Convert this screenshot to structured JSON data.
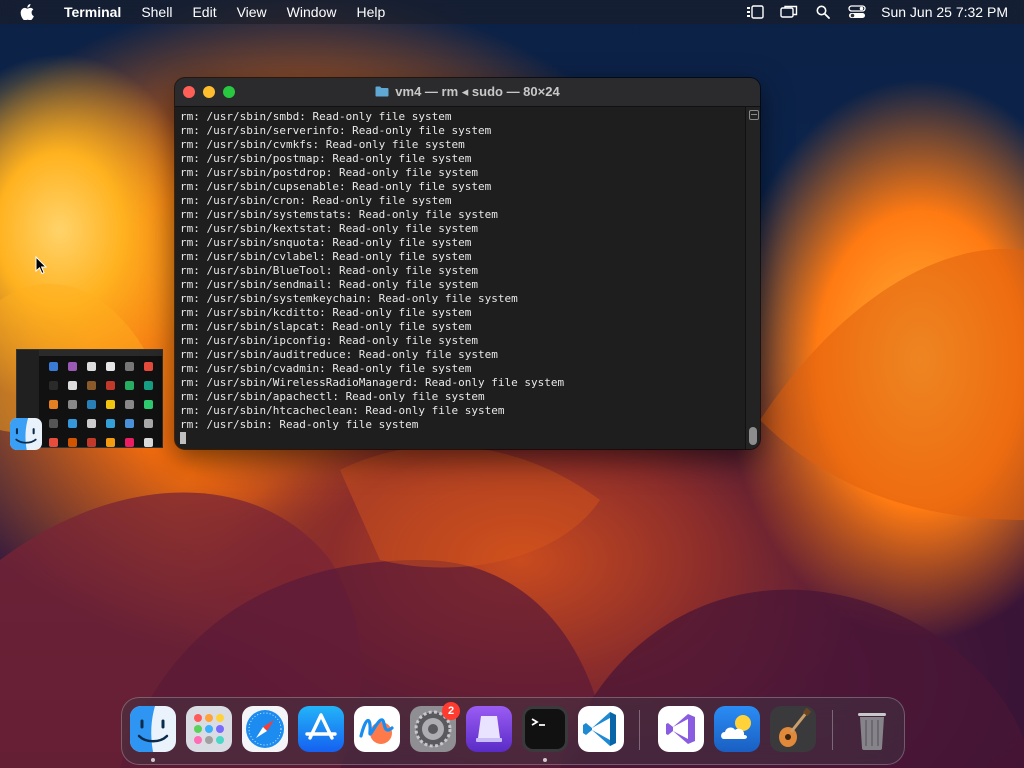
{
  "menubar": {
    "app_name": "Terminal",
    "menus": [
      "Shell",
      "Edit",
      "View",
      "Window",
      "Help"
    ],
    "clock": "Sun Jun 25  7:32 PM"
  },
  "terminal": {
    "title": "vm4 — rm ◂ sudo — 80×24",
    "lines": [
      "rm: /usr/sbin/smbd: Read-only file system",
      "rm: /usr/sbin/serverinfo: Read-only file system",
      "rm: /usr/sbin/cvmkfs: Read-only file system",
      "rm: /usr/sbin/postmap: Read-only file system",
      "rm: /usr/sbin/postdrop: Read-only file system",
      "rm: /usr/sbin/cupsenable: Read-only file system",
      "rm: /usr/sbin/cron: Read-only file system",
      "rm: /usr/sbin/systemstats: Read-only file system",
      "rm: /usr/sbin/kextstat: Read-only file system",
      "rm: /usr/sbin/snquota: Read-only file system",
      "rm: /usr/sbin/cvlabel: Read-only file system",
      "rm: /usr/sbin/BlueTool: Read-only file system",
      "rm: /usr/sbin/sendmail: Read-only file system",
      "rm: /usr/sbin/systemkeychain: Read-only file system",
      "rm: /usr/sbin/kcditto: Read-only file system",
      "rm: /usr/sbin/slapcat: Read-only file system",
      "rm: /usr/sbin/ipconfig: Read-only file system",
      "rm: /usr/sbin/auditreduce: Read-only file system",
      "rm: /usr/sbin/cvadmin: Read-only file system",
      "rm: /usr/sbin/WirelessRadioManagerd: Read-only file system",
      "rm: /usr/sbin/apachectl: Read-only file system",
      "rm: /usr/sbin/htcacheclean: Read-only file system",
      "rm: /usr/sbin: Read-only file system"
    ]
  },
  "dock": {
    "settings_badge": "2"
  },
  "colors": {
    "terminal_bg": "#1e1e1e",
    "badge": "#ff3b30",
    "close": "#ff5f57",
    "minimize": "#febc2e",
    "maximize": "#28c840"
  }
}
